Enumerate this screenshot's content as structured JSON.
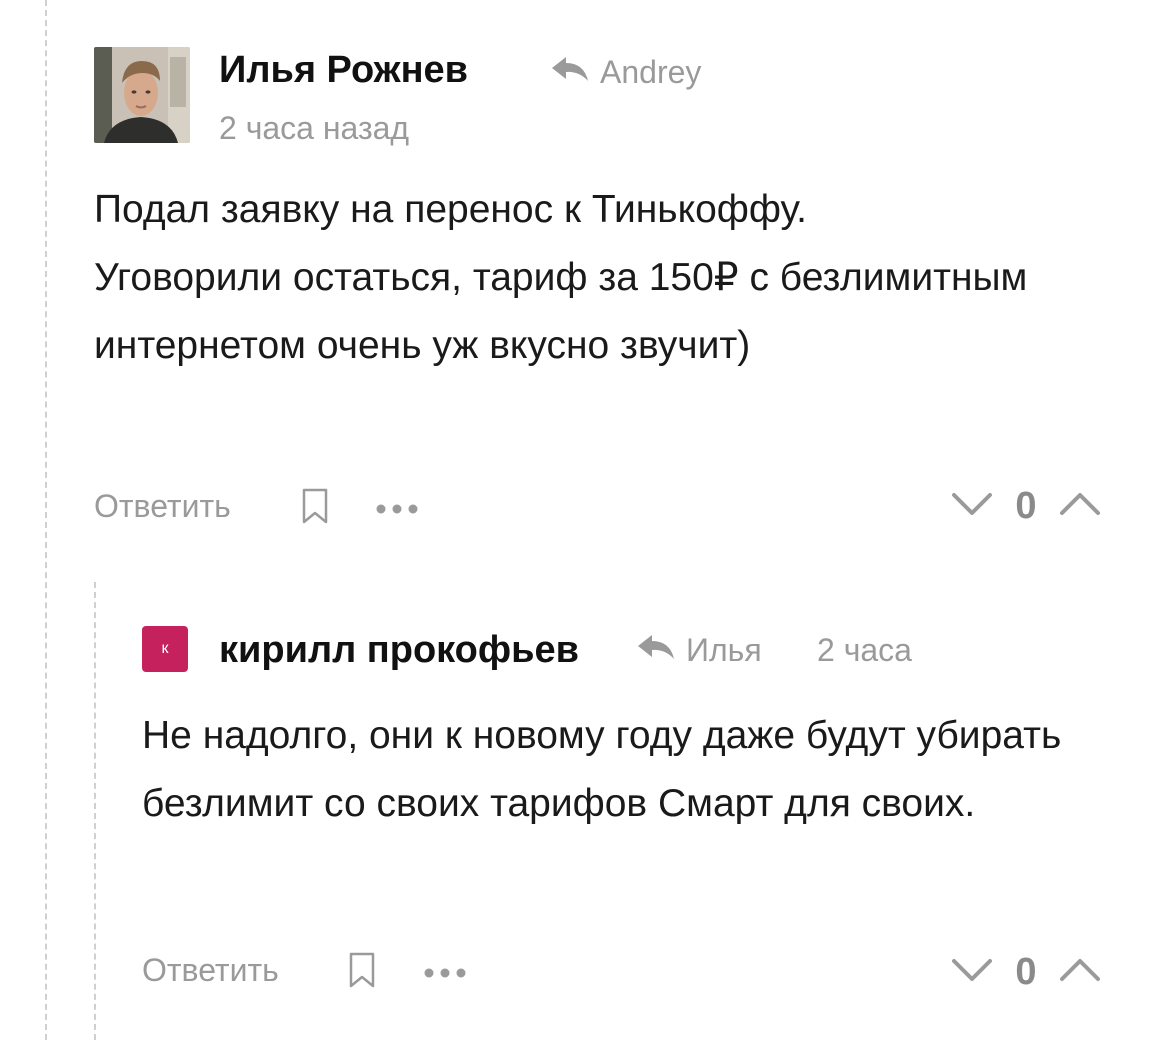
{
  "colors": {
    "accent_avatar": "#c4215d",
    "muted_text": "#9a9a9a",
    "thread_line": "#d0d0d0"
  },
  "comments": [
    {
      "author": "Илья Рожнев",
      "avatar_icon": "user-photo",
      "reply_icon": "reply-arrow-icon",
      "reply_to": "Andrey",
      "time": "2 часа назад",
      "text": "Подал заявку на перенос к Тинькоффу.\nУговорили остаться, тариф за 150₽ с безлимитным интернетом очень уж вкусно звучит)",
      "actions": {
        "reply_label": "Ответить",
        "save_icon": "bookmark-icon",
        "more_icon": "more-dots-icon"
      },
      "rating": "0"
    },
    {
      "author": "кирилл прокофьев",
      "avatar_letter": "к",
      "reply_icon": "reply-arrow-icon",
      "reply_to": "Илья",
      "time": "2 часа",
      "text": "Не надолго, они к новому году даже будут убирать безлимит со своих тарифов Смарт для своих.",
      "actions": {
        "reply_label": "Ответить",
        "save_icon": "bookmark-icon",
        "more_icon": "more-dots-icon"
      },
      "rating": "0"
    }
  ]
}
